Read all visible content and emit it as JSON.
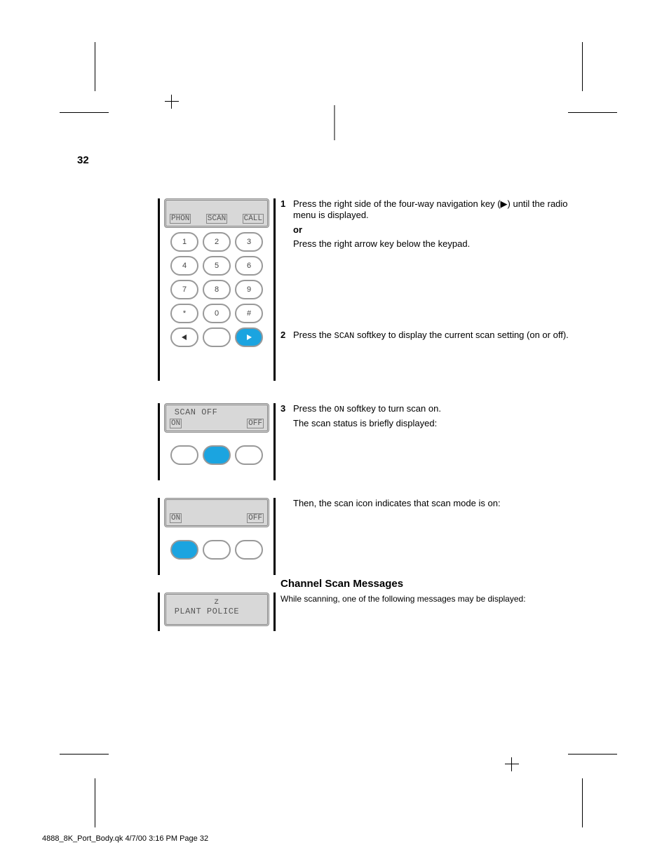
{
  "page_number": "32",
  "panel1": {
    "soft": [
      "PHON",
      "SCAN",
      "CALL"
    ],
    "keypad": [
      [
        "1",
        "2",
        "3"
      ],
      [
        "4",
        "5",
        "6"
      ],
      [
        "7",
        "8",
        "9"
      ],
      [
        "*",
        "0",
        "#"
      ]
    ]
  },
  "text1": {
    "step1_num": "1",
    "step1": "Press the right side of the four-way navigation key (▶) until the radio menu is displayed.",
    "or": "or",
    "step1b": "Press the right arrow key below the keypad.",
    "step2_num": "2",
    "step2_a": "Press the ",
    "step2_soft": "SCAN",
    "step2_b": " softkey to display the current scan setting (on or off)."
  },
  "panel2": {
    "lcd_line1": " SCAN OFF",
    "soft": [
      "ON",
      "",
      "OFF"
    ]
  },
  "text2": {
    "step3_num": "3",
    "step3_a": "Press the ",
    "step3_soft": "ON",
    "step3_b": " softkey to turn scan on.",
    "step3c": "The scan status is briefly displayed:"
  },
  "panel3": {
    "soft_left": "ON",
    "soft_right": "OFF"
  },
  "text3": {
    "line1": "Then, the scan icon indicates that scan mode is on:",
    "h2": "Channel Scan Messages",
    "caption": "While scanning, one of the following messages may be displayed:"
  },
  "panel4": {
    "icon": "z",
    "line2": " PLANT POLICE"
  },
  "footer_file": "4888_8K_Port_Body.qk  4/7/00  3:16 PM  Page 32"
}
